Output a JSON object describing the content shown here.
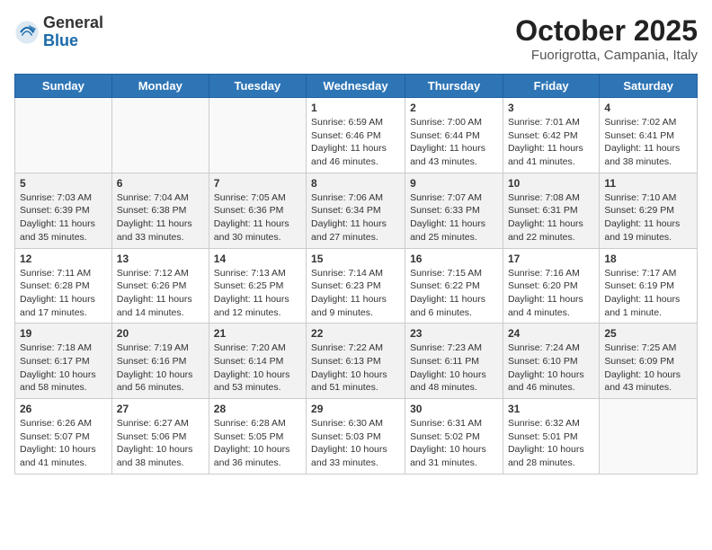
{
  "logo": {
    "general": "General",
    "blue": "Blue"
  },
  "title": "October 2025",
  "subtitle": "Fuorigrotta, Campania, Italy",
  "days_of_week": [
    "Sunday",
    "Monday",
    "Tuesday",
    "Wednesday",
    "Thursday",
    "Friday",
    "Saturday"
  ],
  "weeks": [
    [
      {
        "day": "",
        "info": ""
      },
      {
        "day": "",
        "info": ""
      },
      {
        "day": "",
        "info": ""
      },
      {
        "day": "1",
        "info": "Sunrise: 6:59 AM\nSunset: 6:46 PM\nDaylight: 11 hours and 46 minutes."
      },
      {
        "day": "2",
        "info": "Sunrise: 7:00 AM\nSunset: 6:44 PM\nDaylight: 11 hours and 43 minutes."
      },
      {
        "day": "3",
        "info": "Sunrise: 7:01 AM\nSunset: 6:42 PM\nDaylight: 11 hours and 41 minutes."
      },
      {
        "day": "4",
        "info": "Sunrise: 7:02 AM\nSunset: 6:41 PM\nDaylight: 11 hours and 38 minutes."
      }
    ],
    [
      {
        "day": "5",
        "info": "Sunrise: 7:03 AM\nSunset: 6:39 PM\nDaylight: 11 hours and 35 minutes."
      },
      {
        "day": "6",
        "info": "Sunrise: 7:04 AM\nSunset: 6:38 PM\nDaylight: 11 hours and 33 minutes."
      },
      {
        "day": "7",
        "info": "Sunrise: 7:05 AM\nSunset: 6:36 PM\nDaylight: 11 hours and 30 minutes."
      },
      {
        "day": "8",
        "info": "Sunrise: 7:06 AM\nSunset: 6:34 PM\nDaylight: 11 hours and 27 minutes."
      },
      {
        "day": "9",
        "info": "Sunrise: 7:07 AM\nSunset: 6:33 PM\nDaylight: 11 hours and 25 minutes."
      },
      {
        "day": "10",
        "info": "Sunrise: 7:08 AM\nSunset: 6:31 PM\nDaylight: 11 hours and 22 minutes."
      },
      {
        "day": "11",
        "info": "Sunrise: 7:10 AM\nSunset: 6:29 PM\nDaylight: 11 hours and 19 minutes."
      }
    ],
    [
      {
        "day": "12",
        "info": "Sunrise: 7:11 AM\nSunset: 6:28 PM\nDaylight: 11 hours and 17 minutes."
      },
      {
        "day": "13",
        "info": "Sunrise: 7:12 AM\nSunset: 6:26 PM\nDaylight: 11 hours and 14 minutes."
      },
      {
        "day": "14",
        "info": "Sunrise: 7:13 AM\nSunset: 6:25 PM\nDaylight: 11 hours and 12 minutes."
      },
      {
        "day": "15",
        "info": "Sunrise: 7:14 AM\nSunset: 6:23 PM\nDaylight: 11 hours and 9 minutes."
      },
      {
        "day": "16",
        "info": "Sunrise: 7:15 AM\nSunset: 6:22 PM\nDaylight: 11 hours and 6 minutes."
      },
      {
        "day": "17",
        "info": "Sunrise: 7:16 AM\nSunset: 6:20 PM\nDaylight: 11 hours and 4 minutes."
      },
      {
        "day": "18",
        "info": "Sunrise: 7:17 AM\nSunset: 6:19 PM\nDaylight: 11 hours and 1 minute."
      }
    ],
    [
      {
        "day": "19",
        "info": "Sunrise: 7:18 AM\nSunset: 6:17 PM\nDaylight: 10 hours and 58 minutes."
      },
      {
        "day": "20",
        "info": "Sunrise: 7:19 AM\nSunset: 6:16 PM\nDaylight: 10 hours and 56 minutes."
      },
      {
        "day": "21",
        "info": "Sunrise: 7:20 AM\nSunset: 6:14 PM\nDaylight: 10 hours and 53 minutes."
      },
      {
        "day": "22",
        "info": "Sunrise: 7:22 AM\nSunset: 6:13 PM\nDaylight: 10 hours and 51 minutes."
      },
      {
        "day": "23",
        "info": "Sunrise: 7:23 AM\nSunset: 6:11 PM\nDaylight: 10 hours and 48 minutes."
      },
      {
        "day": "24",
        "info": "Sunrise: 7:24 AM\nSunset: 6:10 PM\nDaylight: 10 hours and 46 minutes."
      },
      {
        "day": "25",
        "info": "Sunrise: 7:25 AM\nSunset: 6:09 PM\nDaylight: 10 hours and 43 minutes."
      }
    ],
    [
      {
        "day": "26",
        "info": "Sunrise: 6:26 AM\nSunset: 5:07 PM\nDaylight: 10 hours and 41 minutes."
      },
      {
        "day": "27",
        "info": "Sunrise: 6:27 AM\nSunset: 5:06 PM\nDaylight: 10 hours and 38 minutes."
      },
      {
        "day": "28",
        "info": "Sunrise: 6:28 AM\nSunset: 5:05 PM\nDaylight: 10 hours and 36 minutes."
      },
      {
        "day": "29",
        "info": "Sunrise: 6:30 AM\nSunset: 5:03 PM\nDaylight: 10 hours and 33 minutes."
      },
      {
        "day": "30",
        "info": "Sunrise: 6:31 AM\nSunset: 5:02 PM\nDaylight: 10 hours and 31 minutes."
      },
      {
        "day": "31",
        "info": "Sunrise: 6:32 AM\nSunset: 5:01 PM\nDaylight: 10 hours and 28 minutes."
      },
      {
        "day": "",
        "info": ""
      }
    ]
  ]
}
